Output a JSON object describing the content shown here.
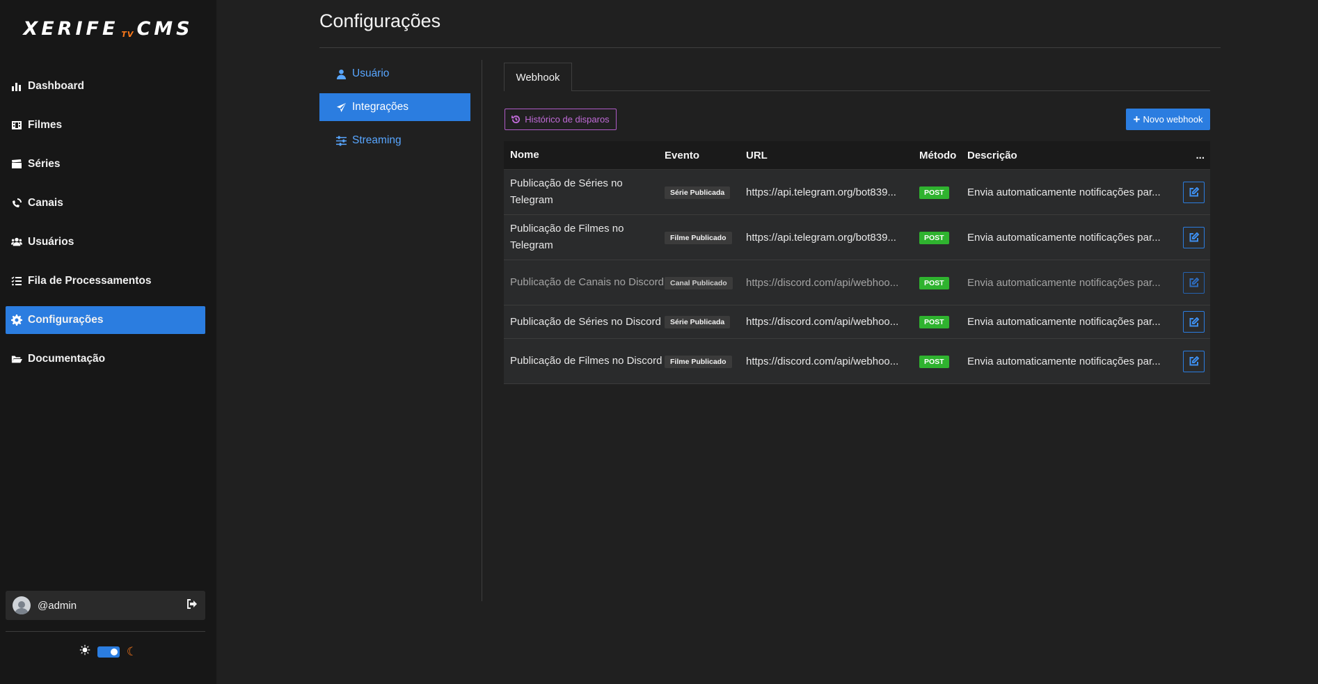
{
  "app": {
    "logo_left": "XERIFE",
    "logo_tv": "TV",
    "logo_right": "CMS"
  },
  "sidebar": {
    "items": [
      {
        "label": "Dashboard",
        "icon": "chart-bar-icon"
      },
      {
        "label": "Filmes",
        "icon": "film-icon"
      },
      {
        "label": "Séries",
        "icon": "clapperboard-icon"
      },
      {
        "label": "Canais",
        "icon": "satellite-dish-icon"
      },
      {
        "label": "Usuários",
        "icon": "users-icon"
      },
      {
        "label": "Fila de Processamentos",
        "icon": "list-check-icon"
      },
      {
        "label": "Configurações",
        "icon": "gear-icon",
        "active": true
      },
      {
        "label": "Documentação",
        "icon": "folder-open-icon"
      }
    ],
    "user": {
      "name": "@admin"
    }
  },
  "page": {
    "title": "Configurações"
  },
  "settings_menu": {
    "items": [
      {
        "label": "Usuário",
        "icon": "user-icon"
      },
      {
        "label": "Integrações",
        "icon": "paper-plane-icon",
        "active": true
      },
      {
        "label": "Streaming",
        "icon": "sliders-icon"
      }
    ]
  },
  "tabs": [
    {
      "label": "Webhook"
    }
  ],
  "toolbar": {
    "history_label": "Histórico de disparos",
    "new_label": "Novo webhook"
  },
  "table": {
    "headers": {
      "name": "Nome",
      "event": "Evento",
      "url": "URL",
      "method": "Método",
      "description": "Descrição",
      "actions": "..."
    },
    "rows": [
      {
        "name": "Publicação de Séries no Telegram",
        "event": "Série Publicada",
        "url": "https://api.telegram.org/bot839...",
        "method": "POST",
        "description": "Envia automaticamente notificações par..."
      },
      {
        "name": "Publicação de Filmes no Telegram",
        "event": "Filme Publicado",
        "url": "https://api.telegram.org/bot839...",
        "method": "POST",
        "description": "Envia automaticamente notificações par..."
      },
      {
        "name": "Publicação de Canais no Discord",
        "event": "Canal Publicado",
        "url": "https://discord.com/api/webhoo...",
        "method": "POST",
        "description": "Envia automaticamente notificações par..."
      },
      {
        "name": "Publicação de Séries no Discord",
        "event": "Série Publicada",
        "url": "https://discord.com/api/webhoo...",
        "method": "POST",
        "description": "Envia automaticamente notificações par..."
      },
      {
        "name": "Publicação de Filmes no Discord",
        "event": "Filme Publicado",
        "url": "https://discord.com/api/webhoo...",
        "method": "POST",
        "description": "Envia automaticamente notificações par..."
      }
    ]
  },
  "colors": {
    "accent": "#2b7de0",
    "success": "#2fb32f",
    "history": "#c16bd8",
    "theme_moon": "#ff7a1a"
  }
}
